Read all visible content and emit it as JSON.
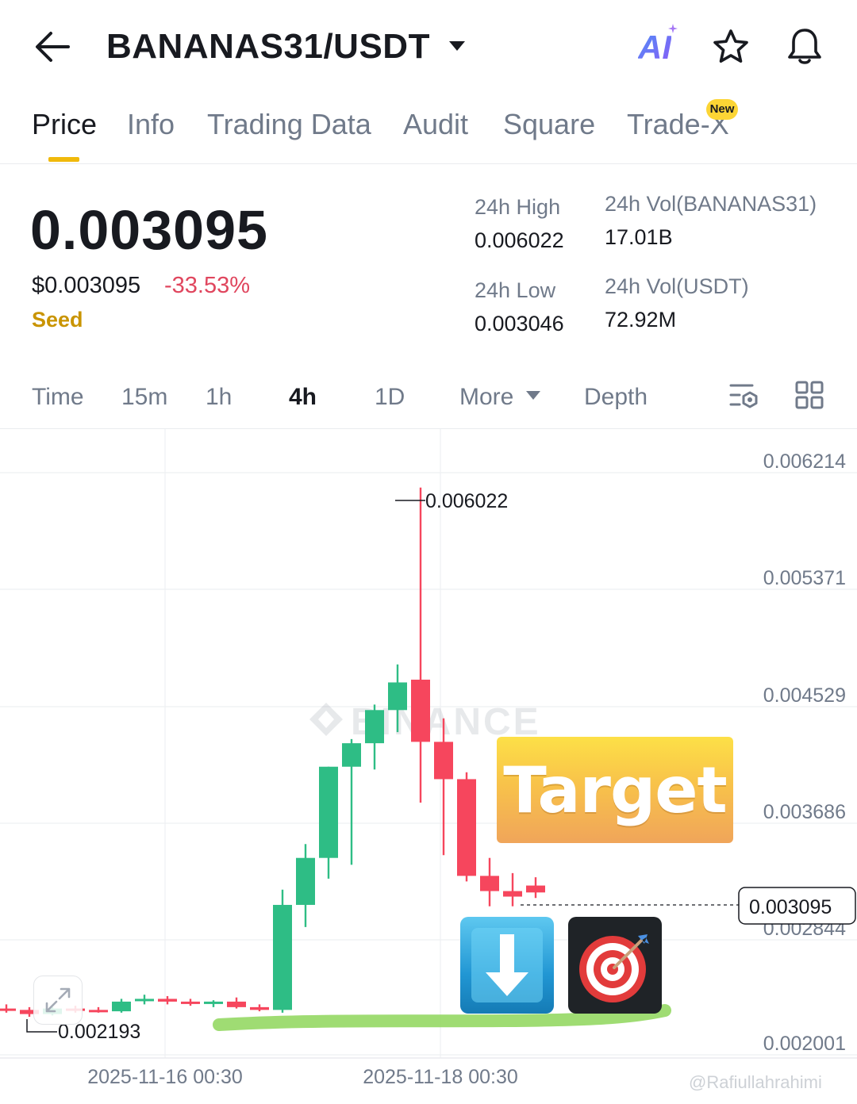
{
  "header": {
    "pair": "BANANAS31/USDT",
    "ai_label": "AI"
  },
  "tabs": [
    {
      "label": "Price",
      "active": true
    },
    {
      "label": "Info"
    },
    {
      "label": "Trading Data"
    },
    {
      "label": "Audit"
    },
    {
      "label": "Square"
    },
    {
      "label": "Trade-X",
      "badge": "New"
    }
  ],
  "ticker": {
    "last_price": "0.003095",
    "usd_price": "$0.003095",
    "change_pct": "-33.53%",
    "tag": "Seed",
    "high_label": "24h High",
    "high_value": "0.006022",
    "low_label": "24h Low",
    "low_value": "0.003046",
    "vol_base_label": "24h Vol(BANANAS31)",
    "vol_base_value": "17.01B",
    "vol_quote_label": "24h Vol(USDT)",
    "vol_quote_value": "72.92M"
  },
  "intervals": {
    "items": [
      "Time",
      "15m",
      "1h",
      "4h",
      "1D",
      "More",
      "Depth"
    ],
    "active": "4h"
  },
  "colors": {
    "up": "#2ebd85",
    "down": "#f6465d",
    "accent": "#f0b90b",
    "support_line": "#7ed321"
  },
  "chart_data": {
    "type": "candlestick",
    "y_ticks": [
      "0.006214",
      "0.005371",
      "0.004529",
      "0.003686",
      "0.002844",
      "0.002001"
    ],
    "x_ticks": [
      "2025-11-16 00:30",
      "2025-11-18 00:30"
    ],
    "high_marker": "0.006022",
    "low_marker": "0.002193",
    "last_price_label": "0.003095",
    "watermark": "BINANCE",
    "annotation": "Target",
    "credit": "@Rafiullahrahimi",
    "ylim": [
      0.002001,
      0.006214
    ],
    "candles": [
      {
        "o": 0.00225,
        "h": 0.00228,
        "l": 0.00222,
        "c": 0.00224
      },
      {
        "o": 0.00224,
        "h": 0.00226,
        "l": 0.00219,
        "c": 0.00221
      },
      {
        "o": 0.00221,
        "h": 0.00226,
        "l": 0.0022,
        "c": 0.00225
      },
      {
        "o": 0.00225,
        "h": 0.00227,
        "l": 0.00222,
        "c": 0.00224
      },
      {
        "o": 0.00224,
        "h": 0.00226,
        "l": 0.00222,
        "c": 0.00223
      },
      {
        "o": 0.00223,
        "h": 0.00232,
        "l": 0.00222,
        "c": 0.0023
      },
      {
        "o": 0.00231,
        "h": 0.00235,
        "l": 0.00228,
        "c": 0.00232
      },
      {
        "o": 0.00232,
        "h": 0.00234,
        "l": 0.00228,
        "c": 0.0023
      },
      {
        "o": 0.0023,
        "h": 0.00232,
        "l": 0.00227,
        "c": 0.00229
      },
      {
        "o": 0.00229,
        "h": 0.00231,
        "l": 0.00226,
        "c": 0.0023
      },
      {
        "o": 0.0023,
        "h": 0.00233,
        "l": 0.00225,
        "c": 0.00226
      },
      {
        "o": 0.00226,
        "h": 0.00228,
        "l": 0.00223,
        "c": 0.00224
      },
      {
        "o": 0.00224,
        "h": 0.00311,
        "l": 0.00222,
        "c": 0.003
      },
      {
        "o": 0.003,
        "h": 0.00344,
        "l": 0.00284,
        "c": 0.00334
      },
      {
        "o": 0.00334,
        "h": 0.004,
        "l": 0.00319,
        "c": 0.004
      },
      {
        "o": 0.004,
        "h": 0.0042,
        "l": 0.00329,
        "c": 0.00417
      },
      {
        "o": 0.00417,
        "h": 0.00445,
        "l": 0.00398,
        "c": 0.00441
      },
      {
        "o": 0.00441,
        "h": 0.00474,
        "l": 0.00425,
        "c": 0.00461
      },
      {
        "o": 0.00463,
        "h": 0.00602,
        "l": 0.00374,
        "c": 0.00418
      },
      {
        "o": 0.00418,
        "h": 0.00435,
        "l": 0.00336,
        "c": 0.00391
      },
      {
        "o": 0.00391,
        "h": 0.00396,
        "l": 0.00317,
        "c": 0.00321
      },
      {
        "o": 0.00321,
        "h": 0.00334,
        "l": 0.00299,
        "c": 0.0031
      },
      {
        "o": 0.0031,
        "h": 0.00323,
        "l": 0.00299,
        "c": 0.00306
      },
      {
        "o": 0.00314,
        "h": 0.0032,
        "l": 0.00305,
        "c": 0.00309
      }
    ]
  }
}
